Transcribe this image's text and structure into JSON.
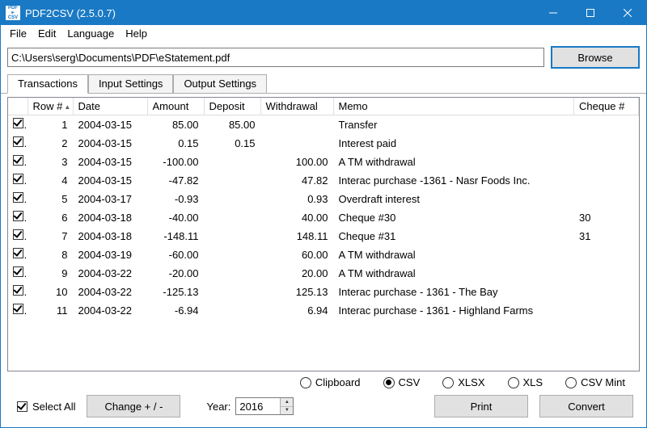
{
  "window": {
    "title": "PDF2CSV (2.5.0.7)"
  },
  "menu": {
    "file": "File",
    "edit": "Edit",
    "language": "Language",
    "help": "Help"
  },
  "toolbar": {
    "path": "C:\\Users\\serg\\Documents\\PDF\\eStatement.pdf",
    "browse": "Browse"
  },
  "tabs": {
    "transactions": "Transactions",
    "input": "Input Settings",
    "output": "Output Settings"
  },
  "columns": {
    "row": "Row #",
    "date": "Date",
    "amount": "Amount",
    "deposit": "Deposit",
    "withdrawal": "Withdrawal",
    "memo": "Memo",
    "cheque": "Cheque #"
  },
  "rows": [
    {
      "n": "1",
      "date": "2004-03-15",
      "amount": "85.00",
      "deposit": "85.00",
      "withdrawal": "",
      "memo": "Transfer",
      "cheque": ""
    },
    {
      "n": "2",
      "date": "2004-03-15",
      "amount": "0.15",
      "deposit": "0.15",
      "withdrawal": "",
      "memo": "Interest paid",
      "cheque": ""
    },
    {
      "n": "3",
      "date": "2004-03-15",
      "amount": "-100.00",
      "deposit": "",
      "withdrawal": "100.00",
      "memo": "A TM withdrawal",
      "cheque": ""
    },
    {
      "n": "4",
      "date": "2004-03-15",
      "amount": "-47.82",
      "deposit": "",
      "withdrawal": "47.82",
      "memo": "Interac purchase -1361 - Nasr Foods Inc.",
      "cheque": ""
    },
    {
      "n": "5",
      "date": "2004-03-17",
      "amount": "-0.93",
      "deposit": "",
      "withdrawal": "0.93",
      "memo": "Overdraft interest",
      "cheque": ""
    },
    {
      "n": "6",
      "date": "2004-03-18",
      "amount": "-40.00",
      "deposit": "",
      "withdrawal": "40.00",
      "memo": "Cheque #30",
      "cheque": "30"
    },
    {
      "n": "7",
      "date": "2004-03-18",
      "amount": "-148.11",
      "deposit": "",
      "withdrawal": "148.11",
      "memo": "Cheque #31",
      "cheque": "31"
    },
    {
      "n": "8",
      "date": "2004-03-19",
      "amount": "-60.00",
      "deposit": "",
      "withdrawal": "60.00",
      "memo": "A TM withdrawal",
      "cheque": ""
    },
    {
      "n": "9",
      "date": "2004-03-22",
      "amount": "-20.00",
      "deposit": "",
      "withdrawal": "20.00",
      "memo": "A TM withdrawal",
      "cheque": ""
    },
    {
      "n": "10",
      "date": "2004-03-22",
      "amount": "-125.13",
      "deposit": "",
      "withdrawal": "125.13",
      "memo": "Interac purchase - 1361 - The Bay",
      "cheque": ""
    },
    {
      "n": "11",
      "date": "2004-03-22",
      "amount": "-6.94",
      "deposit": "",
      "withdrawal": "6.94",
      "memo": "Interac purchase - 1361 - Highland Farms",
      "cheque": ""
    }
  ],
  "formats": {
    "clipboard": "Clipboard",
    "csv": "CSV",
    "xlsx": "XLSX",
    "xls": "XLS",
    "csvmint": "CSV Mint",
    "selected": "csv"
  },
  "bottom": {
    "selectall": "Select All",
    "changesign": "Change + / -",
    "yearlabel": "Year:",
    "yearvalue": "2016",
    "print": "Print",
    "convert": "Convert"
  }
}
